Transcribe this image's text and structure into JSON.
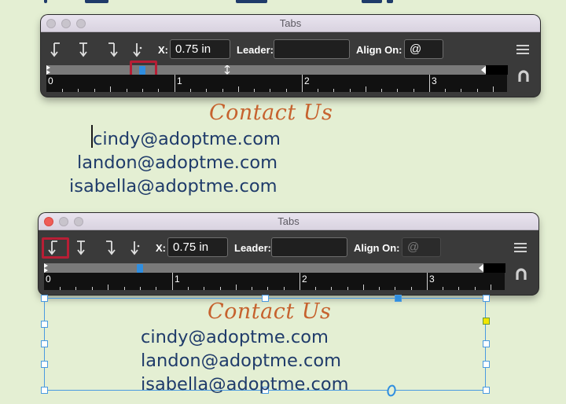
{
  "colors": {
    "background": "#e4efd3",
    "panel": "#3a3a3a",
    "heading": "#c6622e",
    "email_text": "#1f3b6a",
    "selection_highlight": "#b81e35",
    "frame_border": "#4a9ae0"
  },
  "panels": [
    {
      "title": "Tabs",
      "active_window": false,
      "x_label": "X:",
      "x_value": "0.75 in",
      "leader_label": "Leader:",
      "leader_value": "",
      "align_on_label": "Align On:",
      "align_on_value": "@",
      "selected_tab_type": "align-on-character",
      "ruler_numbers": [
        "0",
        "1",
        "2",
        "3"
      ]
    },
    {
      "title": "Tabs",
      "active_window": true,
      "x_label": "X:",
      "x_value": "0.75 in",
      "leader_label": "Leader:",
      "leader_value": "",
      "align_on_label": "Align On:",
      "align_on_value": "@",
      "selected_tab_type": "left-justified",
      "ruler_numbers": [
        "0",
        "1",
        "2",
        "3"
      ]
    }
  ],
  "content_top": {
    "heading": "Contact Us",
    "emails": [
      "cindy@adoptme.com",
      "landon@adoptme.com",
      "isabella@adoptme.com"
    ]
  },
  "content_bottom": {
    "heading": "Contact Us",
    "emails": [
      "cindy@adoptme.com",
      "landon@adoptme.com",
      "isabella@adoptme.com"
    ]
  },
  "icons": {
    "tab_types": [
      "left-tab-icon",
      "center-tab-icon",
      "right-tab-icon",
      "align-tab-icon"
    ],
    "panel_menu": "hamburger-menu-icon",
    "snap": "magnet-icon"
  }
}
